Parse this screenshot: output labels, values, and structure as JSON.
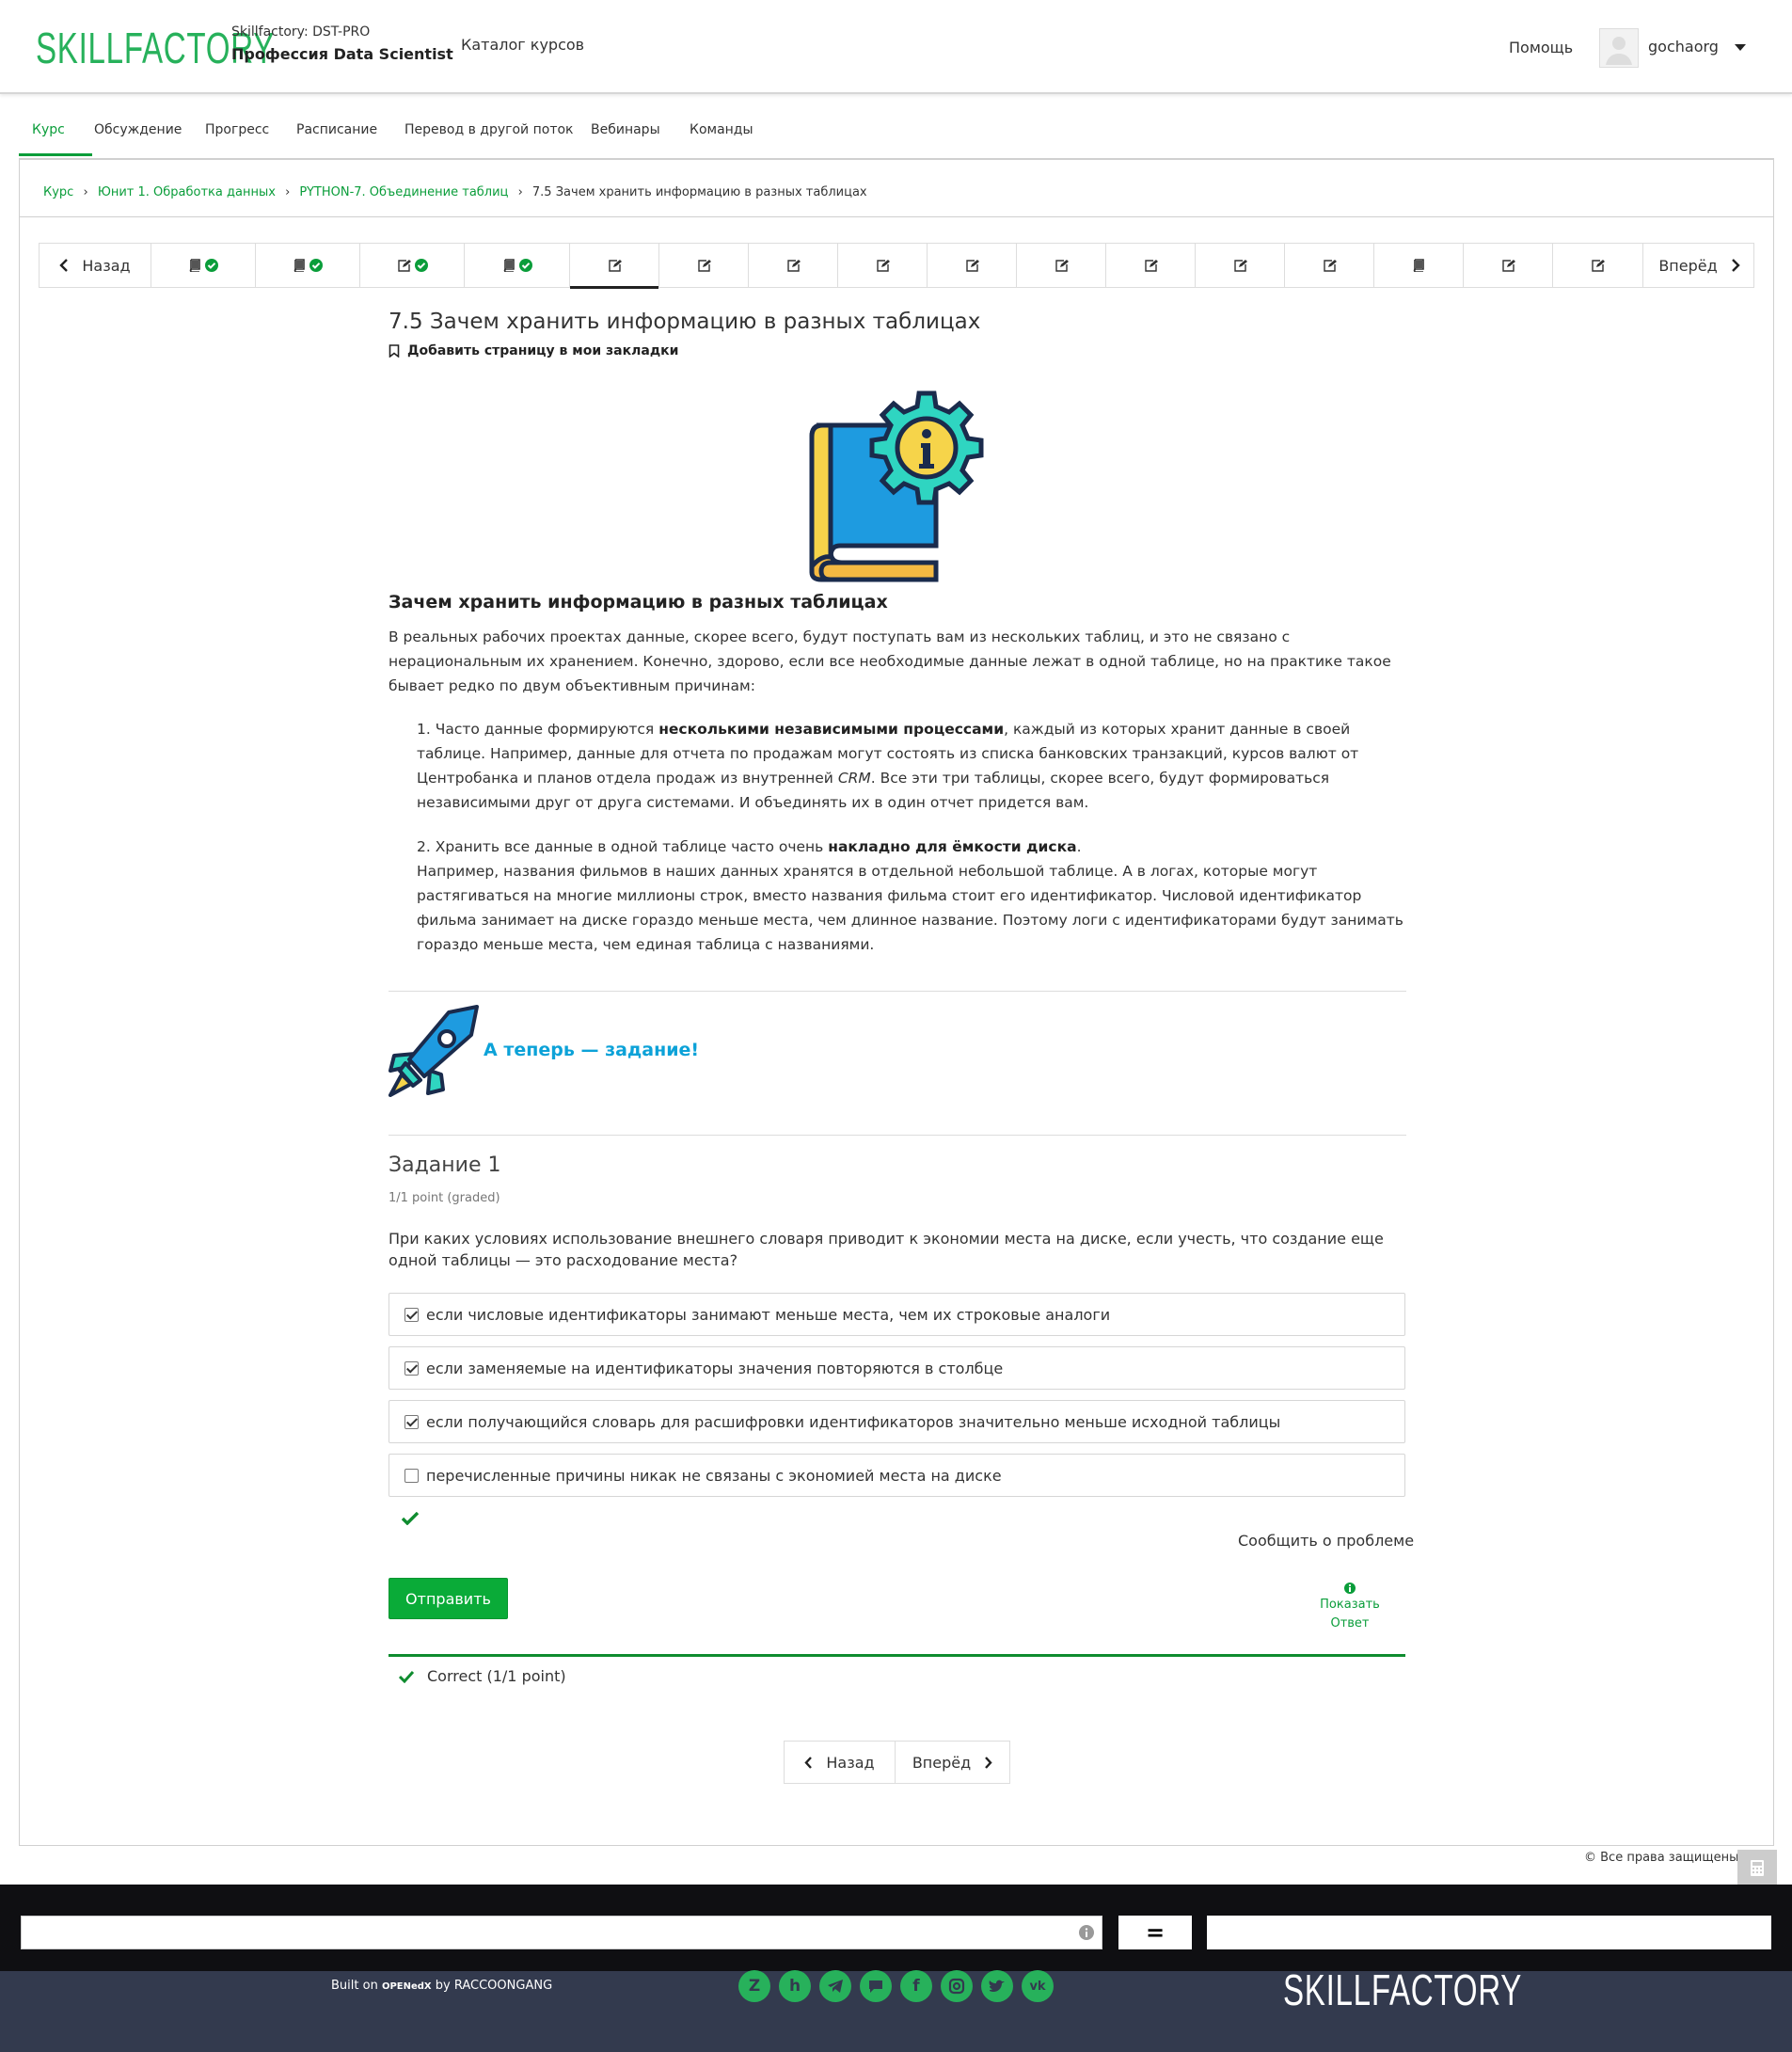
{
  "header": {
    "logo": "SKILLFACTORY",
    "org": "Skillfactory: DST-PRO",
    "program": "Профессия Data Scientist",
    "catalog": "Каталог курсов",
    "help": "Помощь",
    "username": "gochaorg"
  },
  "tabs": [
    "Курс",
    "Обсуждение",
    "Прогресс",
    "Расписание",
    "Перевод в другой поток",
    "Вебинары",
    "Команды"
  ],
  "breadcrumb": {
    "items": [
      "Курс",
      "Юнит 1. Обработка данных",
      "PYTHON-7. Объединение таблиц"
    ],
    "sep": "›",
    "current": "7.5 Зачем хранить информацию в разных таблицах"
  },
  "sequence": {
    "prev": "Назад",
    "next": "Вперёд",
    "units": [
      {
        "icon": "book-icon",
        "done": true
      },
      {
        "icon": "book-icon",
        "done": true
      },
      {
        "icon": "edit-icon",
        "done": true
      },
      {
        "icon": "book-icon",
        "done": true
      },
      {
        "icon": "edit-icon",
        "done": false,
        "active": true
      },
      {
        "icon": "edit-icon",
        "done": false
      },
      {
        "icon": "edit-icon",
        "done": false
      },
      {
        "icon": "edit-icon",
        "done": false
      },
      {
        "icon": "edit-icon",
        "done": false
      },
      {
        "icon": "edit-icon",
        "done": false
      },
      {
        "icon": "edit-icon",
        "done": false
      },
      {
        "icon": "edit-icon",
        "done": false
      },
      {
        "icon": "edit-icon",
        "done": false
      },
      {
        "icon": "book-icon",
        "done": false
      },
      {
        "icon": "edit-icon",
        "done": false
      },
      {
        "icon": "edit-icon",
        "done": false
      }
    ]
  },
  "page": {
    "title": "7.5 Зачем хранить информацию в разных таблицах",
    "bookmark": "Добавить страницу в мои закладки",
    "section_title": "Зачем хранить информацию в разных таблицах",
    "intro": "В реальных рабочих проектах данные, скорее всего, будут поступать вам из нескольких таблиц, и это не связано с нерациональным их хранением. Конечно, здорово, если все необходимые данные лежат в одной таблице, но на практике такое бывает редко по двум объективным причинам:",
    "p1_a": "1. Часто данные формируются ",
    "p1_b": "несколькими независимыми процессами",
    "p1_c": ", каждый из которых хранит данные в своей таблице. Например, данные для отчета по продажам могут состоять из списка банковских транзакций, курсов валют от Центробанка и планов отдела продаж из внутренней ",
    "p1_d": "CRM",
    "p1_e": ". Все эти три таблицы, скорее всего, будут формироваться независимыми друг от друга системами. И объединять их в один отчет придется вам.",
    "p2_a": "2. Хранить все данные в одной таблице часто очень ",
    "p2_b": "накладно для ёмкости диска",
    "p2_c": ".",
    "p2_d": "Например, названия фильмов в наших данных хранятся в отдельной небольшой таблице. А в логах, которые могут растягиваться на многие миллионы строк, вместо названия фильма стоит его идентификатор. Числовой идентификатор фильма занимает на диске гораздо меньше места, чем длинное название. Поэтому логи с идентификаторами будут занимать гораздо меньше места, чем единая таблица с названиями.",
    "task_banner": "А теперь — задание!"
  },
  "problem": {
    "title": "Задание 1",
    "points": "1/1 point (graded)",
    "question": "При каких условиях использование внешнего словаря приводит к экономии места на диске, если учесть, что создание еще одной таблицы — это расходование места?",
    "options": [
      {
        "label": "если числовые идентификаторы занимают меньше места, чем их строковые аналоги",
        "checked": true
      },
      {
        "label": "если заменяемые на идентификаторы значения повторяются в столбце",
        "checked": true
      },
      {
        "label": "если получающийся словарь для расшифровки идентификаторов значительно меньше исходной таблицы",
        "checked": true
      },
      {
        "label": "перечисленные причины никак не связаны с экономией места на диске",
        "checked": false
      }
    ],
    "report": "Сообщить о проблеме",
    "submit": "Отправить",
    "show_answer_1": "Показать",
    "show_answer_2": "Ответ",
    "result": "Correct (1/1 point)"
  },
  "bottom_nav": {
    "prev": "Назад",
    "next": "Вперёд"
  },
  "footer": {
    "copyright": "© Все права защищены",
    "calc_eq": "=",
    "built_on": "Built on",
    "openedx": "OPENedX",
    "by": "by RACCOONGANG",
    "logo": "SKILLFACTORY",
    "social": [
      "zen-icon",
      "habr-icon",
      "telegram-icon",
      "chat-icon",
      "facebook-icon",
      "instagram-icon",
      "twitter-icon",
      "vk-icon"
    ]
  },
  "colors": {
    "brand": "#27b15b",
    "link": "#0a9d3a",
    "accent_blue": "#0ca2d8",
    "footer": "#333a4e"
  }
}
